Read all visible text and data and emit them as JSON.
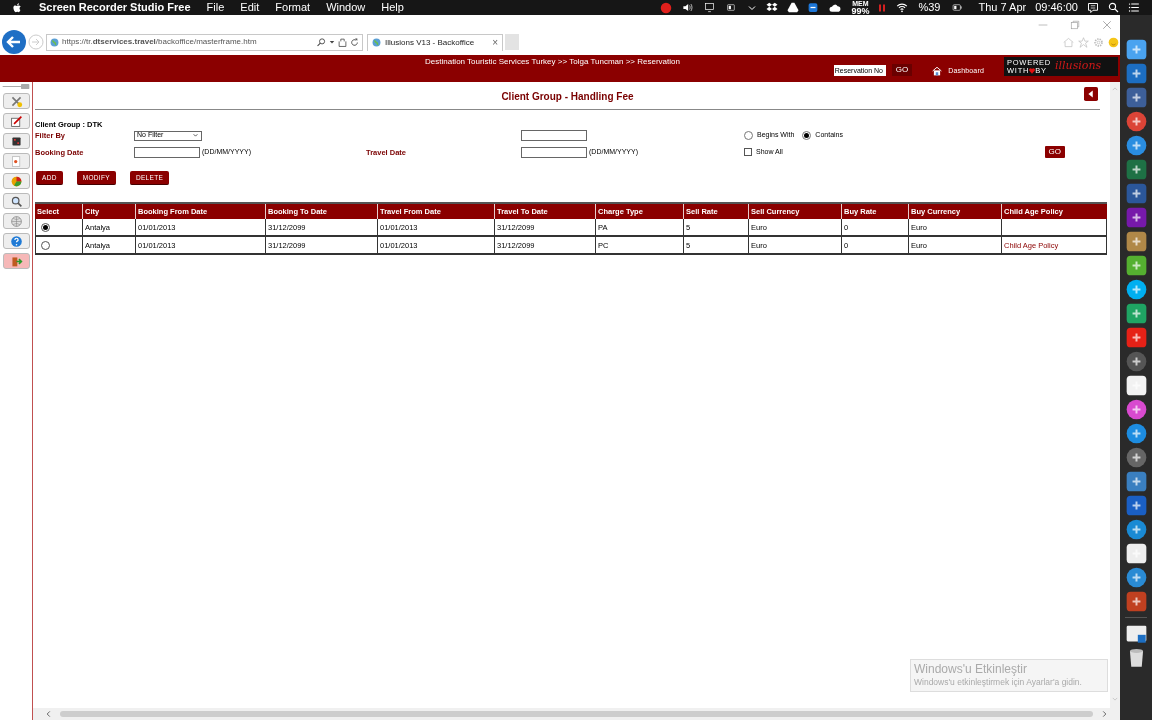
{
  "menubar": {
    "app": "Screen Recorder Studio Free",
    "menus": [
      "File",
      "Edit",
      "Format",
      "Window",
      "Help"
    ],
    "mem_label": "MEM",
    "mem_value": "99%",
    "battery": "%39",
    "date": "Thu 7 Apr",
    "time": "09:46:00"
  },
  "browser": {
    "url": "https://tr.**dtservices.travel**/backoffice/masterframe.htm",
    "tab": "Illusions V13 - Backoffice",
    "tab_close": "×"
  },
  "header": {
    "breadcrumb": "Destination Touristic Services Turkey >> Tolga Tuncman >> Reservation",
    "reservation_placeholder": "Reservation No",
    "go": "GO",
    "dashboard": "Dashboard",
    "powered": "POWERED",
    "with": "WITH",
    "by": "BY",
    "brand": "illusions"
  },
  "page": {
    "title": "Client Group - Handling Fee",
    "client_group": "Client Group : DTK",
    "filter_label": "Filter By",
    "filter_value": "No Filter",
    "booking_date_label": "Booking Date",
    "booking_hint": "(DD/MM/YYYY)",
    "travel_date_label": "Travel Date",
    "travel_hint": "(DD/MM/YYYY)",
    "match_options": [
      {
        "label": "Begins With",
        "selected": false
      },
      {
        "label": "Contains",
        "selected": true
      }
    ],
    "show_all": {
      "label": "Show All",
      "checked": false
    },
    "go": "GO",
    "actions": [
      "ADD",
      "MODIFY",
      "DELETE"
    ]
  },
  "table": {
    "select_header": "Select",
    "columns": [
      "City",
      "Booking From Date",
      "Booking To Date",
      "Travel From Date",
      "Travel To Date",
      "Charge Type",
      "Sell Rate",
      "Sell Currency",
      "Buy Rate",
      "Buy Currency",
      "Child Age Policy"
    ],
    "rows": [
      {
        "selected": true,
        "cells": [
          "Antalya",
          "01/01/2013",
          "31/12/2099",
          "01/01/2013",
          "31/12/2099",
          "PA",
          "5",
          "Euro",
          "0",
          "Euro"
        ]
      },
      {
        "selected": false,
        "cells": [
          "Antalya",
          "01/01/2013",
          "31/12/2099",
          "01/01/2013",
          "31/12/2099",
          "PC",
          "5",
          "Euro",
          "0",
          "Euro",
          "Child Age Policy"
        ]
      }
    ]
  },
  "activation_notice": {
    "title": "Windows'u Etkinleştir",
    "text": "Windows'u etkinleştirmek için Ayarlar'a gidin."
  }
}
